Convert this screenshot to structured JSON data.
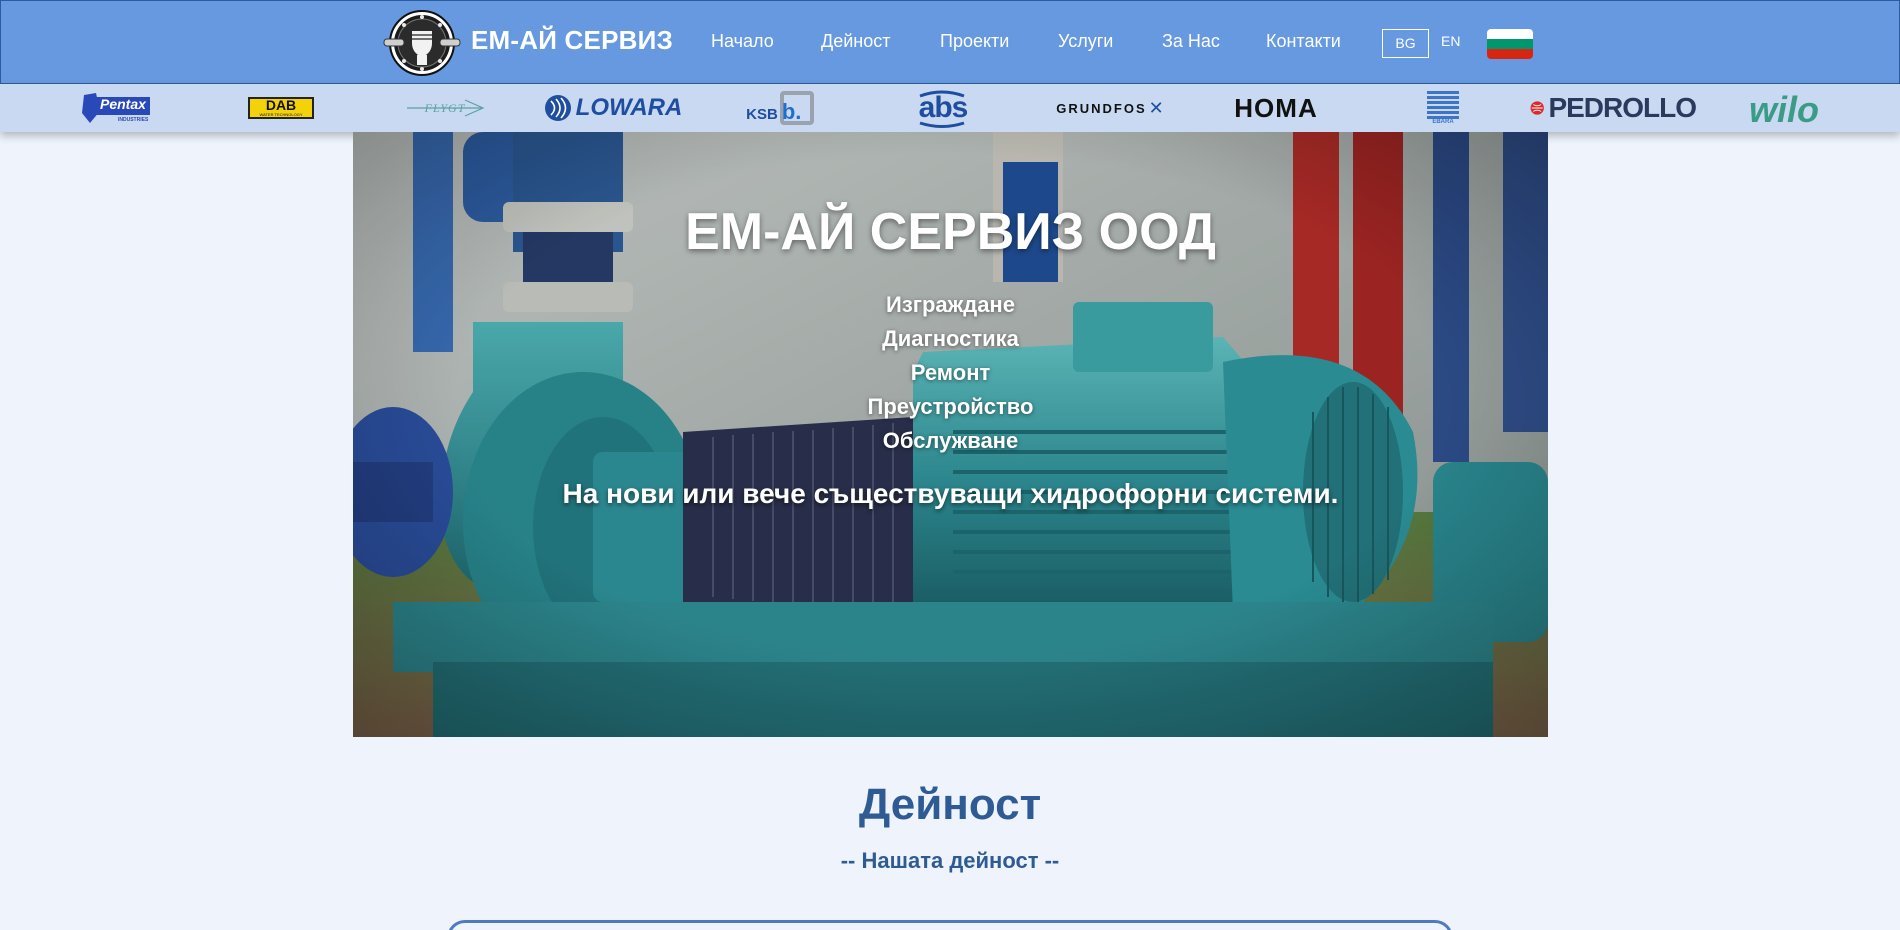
{
  "header": {
    "brand": "ЕМ-АЙ СЕРВИЗ",
    "logo_icon": "fist-wrench-logo-icon",
    "menu": [
      {
        "label": "Начало"
      },
      {
        "label": "Дейност"
      },
      {
        "label": "Проекти"
      },
      {
        "label": "Услуги"
      },
      {
        "label": "За Нас"
      },
      {
        "label": "Контакти"
      }
    ],
    "lang_bg": "BG",
    "lang_en": "EN",
    "flag_icon": "bulgaria-flag-icon",
    "colors": {
      "bar": "#6699e0",
      "text": "#ffffff"
    }
  },
  "brands": [
    {
      "name": "Pentax",
      "sub": "INDUSTRIES"
    },
    {
      "name": "DAB",
      "sub": "WATER TECHNOLOGY"
    },
    {
      "name": "FLYGT"
    },
    {
      "name": "LOWARA"
    },
    {
      "name": "KSB",
      "mark": "b."
    },
    {
      "name": "abs"
    },
    {
      "name": "GRUNDFOS"
    },
    {
      "name": "HOMA"
    },
    {
      "name": "EBARA"
    },
    {
      "name": "PEDROLLO"
    },
    {
      "name": "wilo"
    }
  ],
  "hero": {
    "title": "ЕМ-АЙ СЕРВИЗ ООД",
    "lines": [
      "Изграждане",
      "Диагностика",
      "Ремонт",
      "Преустройство",
      "Обслужване"
    ],
    "tagline": "На нови или вече съществуващи хидрофорни системи.",
    "image_icon": "pump-photo"
  },
  "section": {
    "title": "Дейност",
    "subtitle": "-- Нашата дейност --",
    "color": "#2f5b95"
  }
}
